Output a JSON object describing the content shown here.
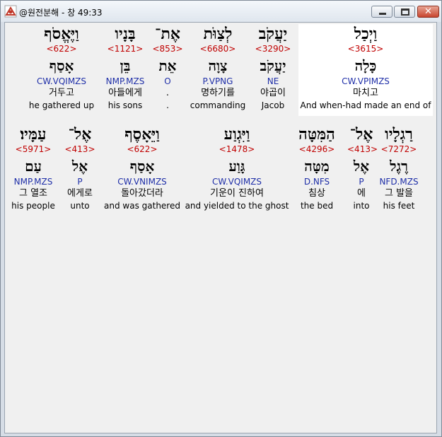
{
  "window": {
    "title": "@원전분해 - 창 49:33",
    "close_glyph": "✕"
  },
  "verse": {
    "reference": "창 49:33",
    "words": [
      {
        "hebrew": "וַיְכַל",
        "strong": "<3615>",
        "lemma": "כָּלָה",
        "morph": "CW.VPIMZS",
        "korean": "마치고",
        "english": "And when-had made an end of",
        "selected": true
      },
      {
        "hebrew": "יַעֲקֹב",
        "strong": "<3290>",
        "lemma": "יַעֲקֹב",
        "morph": "NE",
        "korean": "야곱이",
        "english": "Jacob"
      },
      {
        "hebrew": "לְצַוֹּת",
        "strong": "<6680>",
        "lemma": "צָוָה",
        "morph": "P.VPNG",
        "korean": "명하기를",
        "english": "commanding"
      },
      {
        "hebrew": "אֶת־",
        "strong": "<853>",
        "lemma": "אֵת",
        "morph": "O",
        "korean": ".",
        "english": "."
      },
      {
        "hebrew": "בָּנָיו",
        "strong": "<1121>",
        "lemma": "בֵּן",
        "morph": "NMP.MZS",
        "korean": "아들에게",
        "english": "his sons"
      },
      {
        "hebrew": "וַיֶּאֱסֹף",
        "strong": "<622>",
        "lemma": "אָסַף",
        "morph": "CW.VQIMZS",
        "korean": "거두고",
        "english": "he gathered up"
      },
      {
        "hebrew": "רַגְלָיו",
        "strong": "<7272>",
        "lemma": "רֶגֶל",
        "morph": "NFD.MZS",
        "korean": "그 발을",
        "english": "his feet"
      },
      {
        "hebrew": "אֶל־",
        "strong": "<413>",
        "lemma": "אֶל",
        "morph": "P",
        "korean": "에",
        "english": "into"
      },
      {
        "hebrew": "הַמִּטָּה",
        "strong": "<4296>",
        "lemma": "מִטָּה",
        "morph": "D.NFS",
        "korean": "침상",
        "english": "the bed"
      },
      {
        "hebrew": "וַיִּגְוַע",
        "strong": "<1478>",
        "lemma": "גָּוַע",
        "morph": "CW.VQIMZS",
        "korean": "기운이 진하여",
        "english": "and yielded to the ghost"
      },
      {
        "hebrew": "וַיֵּאָסֶף",
        "strong": "<622>",
        "lemma": "אָסַף",
        "morph": "CW.VNIMZS",
        "korean": "돌아갔더라",
        "english": "and was gathered"
      },
      {
        "hebrew": "אֶל־",
        "strong": "<413>",
        "lemma": "אֶל",
        "morph": "P",
        "korean": "에게로",
        "english": "unto"
      },
      {
        "hebrew": "עַמָּיו׃",
        "strong": "<5971>",
        "lemma": "עַם",
        "morph": "NMP.MZS",
        "korean": "그 열조",
        "english": "his people"
      }
    ]
  },
  "colors": {
    "strong": "#c00000",
    "morph": "#1f2fa8",
    "selected_bg": "#ffffff"
  }
}
